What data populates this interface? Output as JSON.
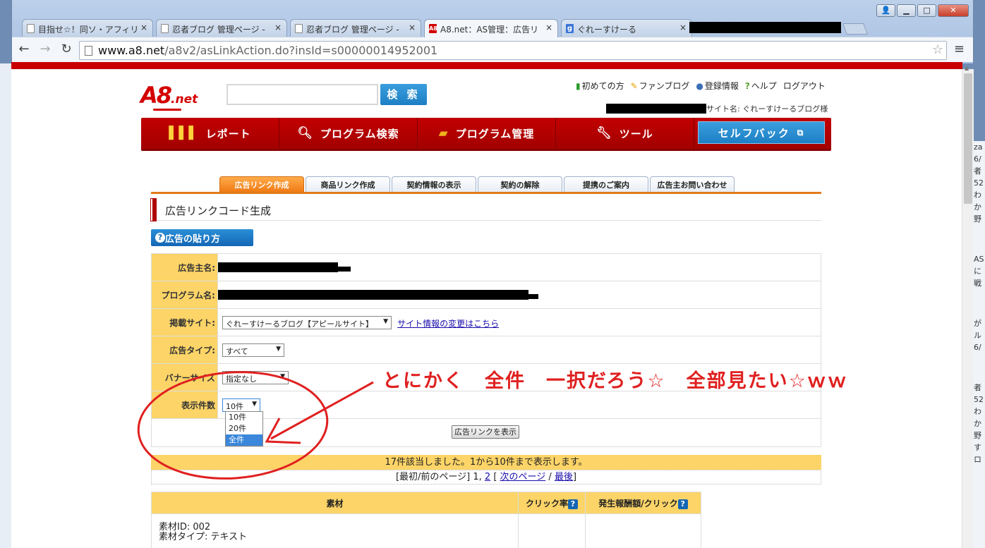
{
  "browser": {
    "tabs": [
      {
        "label": "目指せ☆！同ソ・アフィリ",
        "icon": "page-icon"
      },
      {
        "label": "忍者ブログ 管理ページ -",
        "icon": "page-icon"
      },
      {
        "label": "忍者ブログ 管理ページ -",
        "icon": "page-icon"
      },
      {
        "label": "A8.net：AS管理：広告リ",
        "icon": "a8-icon",
        "active": true
      },
      {
        "label": "ぐれーすけーる",
        "icon": "google-icon"
      }
    ],
    "close_glyph": "×",
    "url_host": "www.a8.net",
    "url_path": "/a8v2/asLinkAction.do?insId=s00000014952001"
  },
  "header": {
    "logo_a8": "A8",
    "logo_net": ".net",
    "search_placeholder": "",
    "search_button": "検 索",
    "links": [
      "初めての方",
      "ファンブログ",
      "登録情報",
      "ヘルプ",
      "ログアウト"
    ],
    "site_name": "サイト名: ぐれーすけーるブログ様"
  },
  "nav": {
    "items": [
      "レポート",
      "プログラム検索",
      "プログラム管理",
      "ツール",
      "セルフバック"
    ]
  },
  "subtabs": [
    "広告リンク作成",
    "商品リンク作成",
    "契約情報の表示",
    "契約の解除",
    "提携のご案内",
    "広告主お問い合わせ"
  ],
  "section_title": "広告リンクコード生成",
  "howto_button": "広告の貼り方",
  "form": {
    "advertiser_label": "広告主名:",
    "program_label": "プログラム名:",
    "site_label": "掲載サイト:",
    "site_value": "ぐれーすけーるブログ【アピールサイト】",
    "site_change_link": "サイト情報の変更はこちら",
    "adtype_label": "広告タイプ:",
    "adtype_value": "すべて",
    "banner_label": "バナーサイズ",
    "banner_value": "指定なし",
    "count_label": "表示件数",
    "count_value": "10件",
    "count_options": [
      "10件",
      "20件",
      "全件"
    ],
    "count_highlighted": "全件",
    "show_button": "広告リンクを表示"
  },
  "annotation": "とにかく　全件　一択だろう☆　全部見たい☆ｗｗ",
  "result": {
    "summary": "17件該当しました。1から10件まで表示します。",
    "pager_prefix": "[最初/前のページ]",
    "page1": "1",
    "page2": "2",
    "next": "次のページ",
    "last": "最後"
  },
  "materials_table": {
    "headers": [
      "素材",
      "クリック率",
      "発生報酬額/クリック"
    ],
    "row1": [
      "素材ID: 002",
      "素材タイプ: テキスト"
    ]
  },
  "right_strip": [
    "za",
    "6/",
    "者",
    "52",
    "わ",
    "か",
    "野",
    "AS",
    "に",
    "戦",
    "が",
    "ル",
    "6/",
    "者",
    "52",
    "わ",
    "か",
    "野",
    "す",
    "ロ"
  ],
  "colors": {
    "brand_red": "#c30000",
    "accent_blue": "#1d7fc4",
    "highlight_yellow": "#fcd467",
    "annotation_red": "#e02020"
  }
}
